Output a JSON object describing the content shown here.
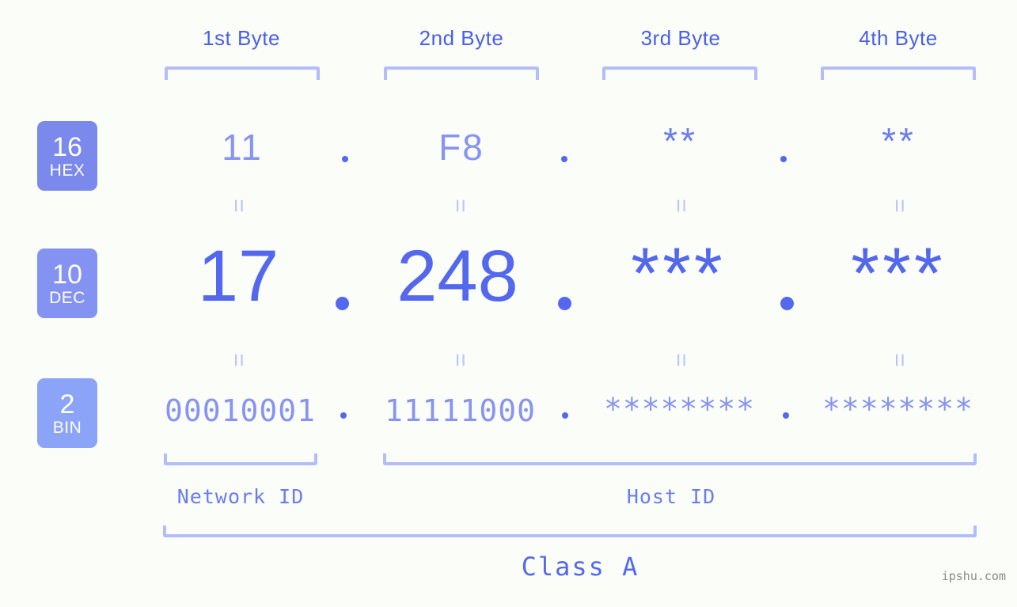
{
  "meta": {
    "background_color": "#fbfdf8",
    "accent_color": "#5468ee",
    "muted_accent_color": "#8794f0",
    "bracket_color": "#b3bdf9",
    "equals_color": "#bcc5f8",
    "watermark": "ipshu.com"
  },
  "columns": [
    {
      "label": "1st Byte"
    },
    {
      "label": "2nd Byte"
    },
    {
      "label": "3rd Byte"
    },
    {
      "label": "4th Byte"
    }
  ],
  "bases": [
    {
      "num": "16",
      "name": "HEX",
      "color": "#7b88ec"
    },
    {
      "num": "10",
      "name": "DEC",
      "color": "#8492f2"
    },
    {
      "num": "2",
      "name": "BIN",
      "color": "#8ba4f7"
    }
  ],
  "rows": {
    "hex": {
      "base": "16",
      "values": [
        "11",
        "F8",
        "**",
        "**"
      ]
    },
    "dec": {
      "base": "10",
      "values": [
        "17",
        "248",
        "***",
        "***"
      ]
    },
    "bin": {
      "base": "2",
      "values": [
        "00010001",
        "11111000",
        "********",
        "********"
      ]
    }
  },
  "separators": {
    "dot": ".",
    "equals": "="
  },
  "segments": [
    {
      "name": "network",
      "label": "Network ID"
    },
    {
      "name": "host",
      "label": "Host ID"
    }
  ],
  "class": {
    "label": "Class A"
  }
}
